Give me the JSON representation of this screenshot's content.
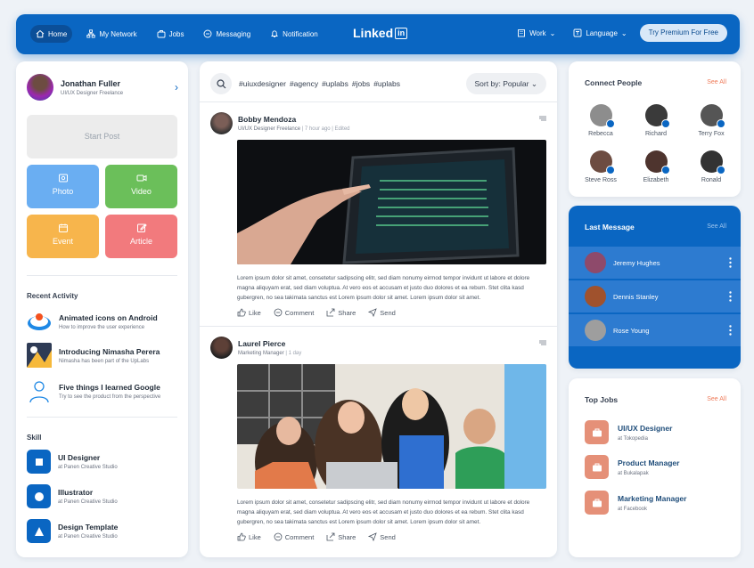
{
  "colors": {
    "brand": "#0a66c2",
    "accent": "#ef7b5a"
  },
  "nav": {
    "home": "Home",
    "network": "My Network",
    "jobs": "Jobs",
    "messaging": "Messaging",
    "notification": "Notification",
    "logo": "Linked",
    "logo_box": "in",
    "work": "Work",
    "language": "Language",
    "premium": "Try Premium For Free"
  },
  "profile": {
    "name": "Jonathan Fuller",
    "role": "UI/UX Designer Freelance"
  },
  "composer": {
    "start_post": "Start Post",
    "photo": "Photo",
    "video": "Video",
    "event": "Event",
    "article": "Article"
  },
  "recent": {
    "title": "Recent Activity",
    "items": [
      {
        "title": "Animated icons on Android",
        "sub": "How to improve the user experience"
      },
      {
        "title": "Introducing Nimasha Perera",
        "sub": "Nimasha has been part of the UpLabs"
      },
      {
        "title": "Five things I learned Google",
        "sub": "Try to see the product from the perspective"
      }
    ]
  },
  "skill": {
    "title": "Skill",
    "items": [
      {
        "title": "UI Designer",
        "sub": "at Panen Creative Studio"
      },
      {
        "title": "Illustrator",
        "sub": "at Panen Creative Studio"
      },
      {
        "title": "Design Template",
        "sub": "at Panen Creative Studio"
      }
    ]
  },
  "feed": {
    "tags": [
      "#uiuxdesigner",
      "#agency",
      "#uplabs",
      "#jobs",
      "#uplabs"
    ],
    "sort_label": "Sort by:",
    "sort_value": "Popular",
    "posts": [
      {
        "name": "Bobby Mendoza",
        "role": "UI/UX Designer Freelance",
        "meta": " | 7 hour ago | Edited",
        "text": "Lorem ipsum dolor sit amet, consetetur sadipscing elitr, sed diam nonumy eirmod tempor invidunt ut labore et dolore magna aliquyam erat, sed diam voluptua. At vero eos et accusam et justo duo dolores et ea rebum. Stet clita kasd gubergren, no sea takimata sanctus est Lorem ipsum dolor sit amet. Lorem ipsum dolor sit amet."
      },
      {
        "name": "Laurel Pierce",
        "role": "Marketing Manager",
        "meta": " | 1 day",
        "text": "Lorem ipsum dolor sit amet, consetetur sadipscing elitr, sed diam nonumy eirmod tempor invidunt ut labore et dolore magna aliquyam erat, sed diam voluptua. At vero eos et accusam et justo duo dolores et ea rebum. Stet clita kasd gubergren, no sea takimata sanctus est Lorem ipsum dolor sit amet. Lorem ipsum dolor sit amet."
      }
    ],
    "actions": {
      "like": "Like",
      "comment": "Comment",
      "share": "Share",
      "send": "Send"
    }
  },
  "connect": {
    "title": "Connect People",
    "see_all": "See All",
    "people": [
      "Rebecca",
      "Richard",
      "Terry Fox",
      "Steve Ross",
      "Elizabeth",
      "Ronald"
    ]
  },
  "last_message": {
    "title": "Last Message",
    "see_all": "See All",
    "items": [
      "Jeremy Hughes",
      "Dennis Stanley",
      "Rose Young"
    ]
  },
  "top_jobs": {
    "title": "Top Jobs",
    "see_all": "See All",
    "items": [
      {
        "title": "UI/UX Designer",
        "sub": "at Tokopedia"
      },
      {
        "title": "Product Manager",
        "sub": "at Bukalapak"
      },
      {
        "title": "Marketing Manager",
        "sub": "at Facebook"
      }
    ]
  }
}
